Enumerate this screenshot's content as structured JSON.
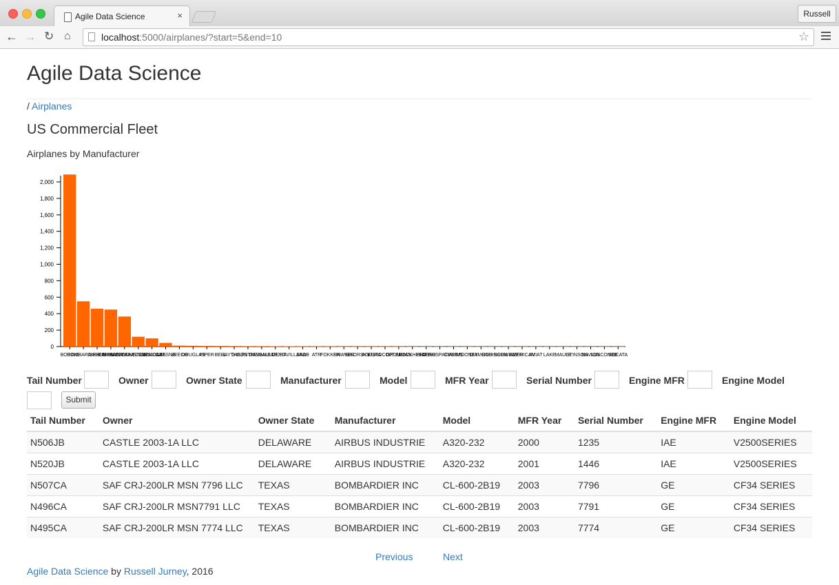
{
  "browser": {
    "tab_title": "Agile Data Science",
    "tab_close": "×",
    "profile": "Russell",
    "url_host": "localhost",
    "url_rest": ":5000/airplanes/?start=5&end=10",
    "icons": [
      "back-icon",
      "forward-icon",
      "reload-icon",
      "home-icon",
      "star-icon",
      "menu-icon"
    ]
  },
  "page": {
    "title": "Agile Data Science",
    "crumb_sep": "/",
    "crumb_link": "Airplanes",
    "heading": "US Commercial Fleet",
    "chart_title": "Airplanes by Manufacturer"
  },
  "chart_data": {
    "type": "bar",
    "color": "#ff6600",
    "categories": [
      "BOEING",
      "BOMBARDIER",
      "AIRBUS",
      "EMBRAER",
      "AIRBUS INDUSTRIE",
      "MCDONNELL DOUGLAS",
      "CANADAIR",
      "CESSNA",
      "BEECH",
      "DOUGLAS",
      "PIPER",
      "BELL",
      "RAYTHEON",
      "GULFSTREAM",
      "DASSAULT",
      "LEARJET",
      "DE HAVILLAND",
      "SAAB",
      "ATR",
      "FOKKER",
      "HAWKER",
      "SIKORSKY",
      "AGUSTA",
      "EUROCOPTER",
      "GRUMMAN",
      "LOCKHEED",
      "BRITISH",
      "AEROSPATIALE",
      "CIRRUS",
      "MOONEY",
      "DIAMOND",
      "ROBINSON",
      "SCHWEIZER",
      "AMERICAN",
      "AVIAT",
      "LAKE",
      "MAULE",
      "STINSON",
      "NAVION",
      "LUSCOMBE",
      "SOCATA"
    ],
    "values": [
      2090,
      550,
      460,
      450,
      365,
      120,
      100,
      45,
      12,
      10,
      8,
      7,
      6,
      5,
      5,
      4,
      4,
      3,
      3,
      3,
      2,
      2,
      2,
      2,
      2,
      1,
      1,
      1,
      1,
      1,
      1,
      1,
      1,
      1,
      1,
      1,
      1,
      1,
      1,
      1,
      1
    ],
    "y_ticks": [
      "0",
      "200",
      "400",
      "600",
      "800",
      "1,000",
      "1,200",
      "1,400",
      "1,600",
      "1,800",
      "2,000"
    ],
    "ylim": [
      0,
      2000
    ],
    "title": "",
    "xlabel": "",
    "ylabel": ""
  },
  "form": {
    "fields": [
      {
        "label": "Tail Number",
        "value": ""
      },
      {
        "label": "Owner",
        "value": ""
      },
      {
        "label": "Owner State",
        "value": ""
      },
      {
        "label": "Manufacturer",
        "value": ""
      },
      {
        "label": "Model",
        "value": ""
      },
      {
        "label": "MFR Year",
        "value": ""
      },
      {
        "label": "Serial Number",
        "value": ""
      },
      {
        "label": "Engine MFR",
        "value": ""
      },
      {
        "label": "Engine Model",
        "value": ""
      }
    ],
    "submit": "Submit"
  },
  "table": {
    "headers": [
      "Tail Number",
      "Owner",
      "Owner State",
      "Manufacturer",
      "Model",
      "MFR Year",
      "Serial Number",
      "Engine MFR",
      "Engine Model"
    ],
    "rows": [
      [
        "N506JB",
        "CASTLE 2003-1A LLC",
        "DELAWARE",
        "AIRBUS INDUSTRIE",
        "A320-232",
        "2000",
        "1235",
        "IAE",
        "V2500SERIES"
      ],
      [
        "N520JB",
        "CASTLE 2003-1A LLC",
        "DELAWARE",
        "AIRBUS INDUSTRIE",
        "A320-232",
        "2001",
        "1446",
        "IAE",
        "V2500SERIES"
      ],
      [
        "N507CA",
        "SAF CRJ-200LR MSN 7796 LLC",
        "TEXAS",
        "BOMBARDIER INC",
        "CL-600-2B19",
        "2003",
        "7796",
        "GE",
        "CF34 SERIES"
      ],
      [
        "N496CA",
        "SAF CRJ-200LR MSN7791 LLC",
        "TEXAS",
        "BOMBARDIER INC",
        "CL-600-2B19",
        "2003",
        "7791",
        "GE",
        "CF34 SERIES"
      ],
      [
        "N495CA",
        "SAF CRJ-200LR MSN 7774 LLC",
        "TEXAS",
        "BOMBARDIER INC",
        "CL-600-2B19",
        "2003",
        "7774",
        "GE",
        "CF34 SERIES"
      ]
    ]
  },
  "pager": {
    "previous": "Previous",
    "next": "Next"
  },
  "footer": {
    "site": "Agile Data Science",
    "by": " by ",
    "author": "Russell Jurney",
    "year": ", 2016"
  }
}
